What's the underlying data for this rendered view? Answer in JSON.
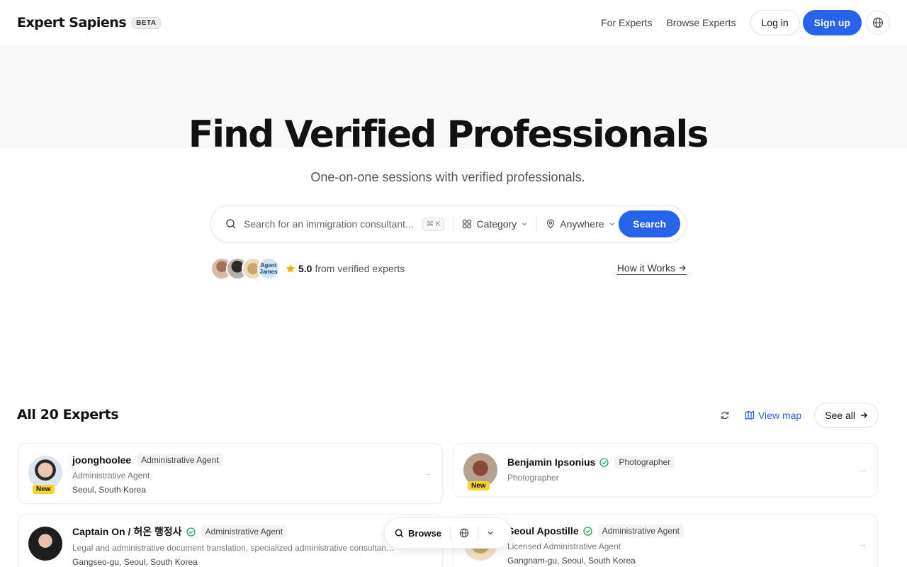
{
  "header": {
    "brand": "Expert Sapiens",
    "badge": "BETA",
    "nav": [
      "For Experts",
      "Browse Experts"
    ],
    "login": "Log in",
    "signup": "Sign up"
  },
  "hero": {
    "title": "Find Verified Professionals",
    "subtitle": "One-on-one sessions with verified professionals.",
    "search": {
      "placeholder": "Search for an immigration consultant...",
      "shortcut": "⌘ K",
      "category": "Category",
      "location": "Anywhere",
      "button": "Search"
    },
    "trust": {
      "avatar_text": "Agent James",
      "score": "5.0",
      "text": "from verified experts",
      "how_it_works": "How it Works"
    }
  },
  "experts": {
    "title": "All 20 Experts",
    "view_map": "View map",
    "see_all": "See all",
    "cards": [
      {
        "name": "joonghoolee",
        "tag": "Administrative Agent",
        "desc": "Administrative Agent",
        "location": "Seoul, South Korea",
        "new": "New"
      },
      {
        "name": "Benjamin Ipsonius",
        "tag": "Photographer",
        "desc": "Photographer",
        "new": "New"
      },
      {
        "name": "Captain On / 허온 행정사",
        "tag": "Administrative Agent",
        "desc": "Legal and administrative document translation, specialized administrative consultan…",
        "location": "Gangseo-gu, Seoul, South Korea"
      },
      {
        "name": "Seoul Apostille",
        "tag": "Administrative Agent",
        "desc": "Licensed Administrative Agent",
        "location": "Gangnam-gu, Seoul, South Korea"
      }
    ]
  },
  "floatbar": {
    "browse": "Browse"
  },
  "colors": {
    "accent": "#2563eb",
    "new_badge": "#fbd32a",
    "verified": "#22a35a"
  }
}
